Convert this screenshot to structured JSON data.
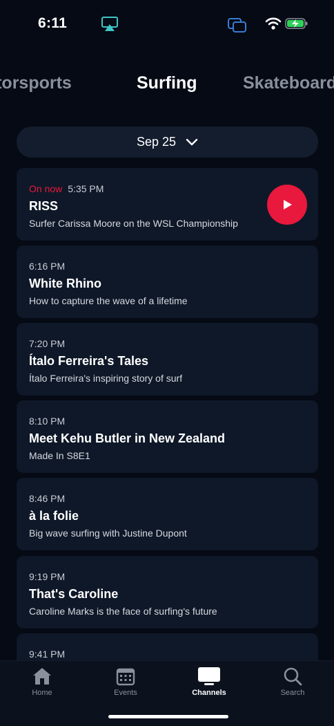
{
  "status_bar": {
    "time": "6:11",
    "icons": [
      "airplay-icon",
      "screen-mirroring-icon",
      "wifi-icon",
      "battery-charging-icon"
    ]
  },
  "category_tabs": [
    {
      "label": "Motorsports",
      "active": false
    },
    {
      "label": "Surfing",
      "active": true
    },
    {
      "label": "Skateboarding",
      "active": false
    }
  ],
  "date_selector": {
    "label": "Sep 25",
    "icon": "chevron-down-icon"
  },
  "programs": [
    {
      "badge": "On now",
      "time": "5:35 PM",
      "title": "RISS",
      "subtitle": "Surfer Carissa Moore on the WSL Championship",
      "has_play": true
    },
    {
      "badge": "",
      "time": "6:16 PM",
      "title": "White Rhino",
      "subtitle": "How to capture the wave of a lifetime",
      "has_play": false
    },
    {
      "badge": "",
      "time": "7:20 PM",
      "title": "Ítalo Ferreira's Tales",
      "subtitle": "Ítalo Ferreira's inspiring story of surf",
      "has_play": false
    },
    {
      "badge": "",
      "time": "8:10 PM",
      "title": "Meet Kehu Butler in New Zealand",
      "subtitle": "Made In S8E1",
      "has_play": false
    },
    {
      "badge": "",
      "time": "8:46 PM",
      "title": "à la folie",
      "subtitle": " Big wave surfing with Justine Dupont",
      "has_play": false
    },
    {
      "badge": "",
      "time": "9:19 PM",
      "title": "That's Caroline",
      "subtitle": "Caroline Marks is the face of surfing's future",
      "has_play": false
    },
    {
      "badge": "",
      "time": "9:41 PM",
      "title": "",
      "subtitle": "",
      "has_play": false
    }
  ],
  "tab_bar": {
    "items": [
      {
        "label": "Home",
        "icon": "home-icon",
        "active": false
      },
      {
        "label": "Events",
        "icon": "calendar-icon",
        "active": false
      },
      {
        "label": "Channels",
        "icon": "tv-icon",
        "active": true
      },
      {
        "label": "Search",
        "icon": "search-icon",
        "active": false
      }
    ]
  },
  "colors": {
    "background": "#050a14",
    "card": "#0f1828",
    "accent_red": "#e8193c",
    "muted": "#8a909c"
  }
}
